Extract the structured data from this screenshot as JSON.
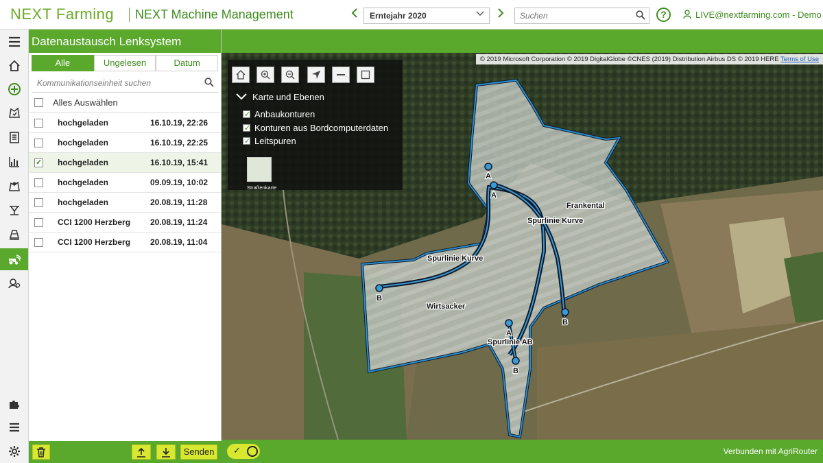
{
  "header": {
    "logo_text": "NEXT Farming",
    "product_title": "NEXT Machine Management",
    "year_label": "Erntejahr 2020",
    "search_placeholder": "Suchen",
    "help_glyph": "?",
    "user_label": "LIVE@nextfarming.com - Demo"
  },
  "nav": {
    "items": [
      "menu-icon",
      "home-icon",
      "add-icon",
      "field-map-icon",
      "clipboard-icon",
      "bar-chart-icon",
      "map-pin-icon",
      "sprayer-icon",
      "machine-icon",
      "tractor-wifi-icon",
      "settings-user-icon",
      "puzzle-icon",
      "list-icon",
      "gear-icon"
    ],
    "active": "tractor-wifi-icon"
  },
  "panel": {
    "title": "Datenaustausch Lenksystem",
    "tabs": [
      {
        "label": "Alle",
        "active": true
      },
      {
        "label": "Ungelesen",
        "active": false
      },
      {
        "label": "Datum",
        "active": false
      }
    ],
    "search_placeholder": "Kommunikationseinheit suchen",
    "select_all_label": "Alles Auswählen",
    "rows": [
      {
        "name": "hochgeladen",
        "date": "16.10.19, 22:26",
        "checked": false
      },
      {
        "name": "hochgeladen",
        "date": "16.10.19, 22:25",
        "checked": false
      },
      {
        "name": "hochgeladen",
        "date": "16.10.19, 15:41",
        "checked": true
      },
      {
        "name": "hochgeladen",
        "date": "09.09.19, 10:02",
        "checked": false
      },
      {
        "name": "hochgeladen",
        "date": "20.08.19, 11:28",
        "checked": false
      },
      {
        "name": "CCI 1200 Herzberg",
        "date": "20.08.19, 11:24",
        "checked": false
      },
      {
        "name": "CCI 1200 Herzberg",
        "date": "20.08.19, 11:04",
        "checked": false
      }
    ],
    "send_label": "Senden"
  },
  "map": {
    "copyright": "© 2019 Microsoft Corporation © 2019 DigitalGlobe ©CNES (2019) Distribution Airbus DS © 2019 HERE",
    "terms_label": "Terms of Use",
    "layers_title": "Karte und Ebenen",
    "layers": [
      {
        "label": "Anbaukonturen",
        "checked": true
      },
      {
        "label": "Konturen aus Bordcomputerdaten",
        "checked": true
      },
      {
        "label": "Leitspuren",
        "checked": true
      }
    ],
    "basemap_label": "Straßenkarte",
    "labels": {
      "frankental": "Frankental",
      "wirtsacker": "Wirtsacker",
      "spurlinie_kurve_1": "Spurlinie Kurve",
      "spurlinie_kurve_2": "Spurlinie Kurve",
      "spurlinie_ab": "Spurlinie AB",
      "a1": "A",
      "a2": "A",
      "a3": "A",
      "b1": "B",
      "b2": "B",
      "b3": "B"
    }
  },
  "footer": {
    "status": "Verbunden mit AgriRouter"
  },
  "colors": {
    "brand_green": "#5aa82c",
    "accent_yellow": "#d8e830",
    "field_outline": "#1b7fc4"
  }
}
